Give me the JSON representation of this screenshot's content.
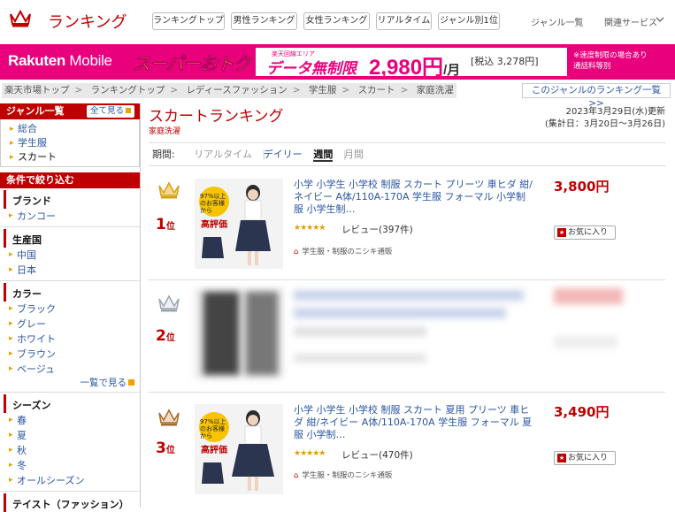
{
  "header": {
    "title": "ランキング",
    "nav": [
      "ランキングトップ",
      "男性ランキング",
      "女性ランキング",
      "リアルタイム",
      "ジャンル別1位"
    ],
    "genre_link": "ジャンル一覧",
    "related": "関連サービス"
  },
  "banner": {
    "brand": "Rakuten",
    "brand2": "Mobile",
    "super": "スーパーおトク",
    "data_top": "楽天回線エリア",
    "data_main": "データ無制限",
    "price": "2,980円",
    "per": "/月",
    "tax": "[税込 3,278円]",
    "note1": "※速度制限の場合あり",
    "note2": "通話料等別"
  },
  "breadcrumb": [
    "楽天市場トップ",
    "ランキングトップ",
    "レディースファッション",
    "学生服",
    "スカート",
    "家庭洗濯"
  ],
  "genre_ranking_link": "このジャンルのランキング一覧 >>",
  "sidebar": {
    "genre_head": "ジャンル一覧",
    "show_all": "全て見る",
    "genres": [
      "総合",
      "学生服",
      "スカート"
    ],
    "cond_head": "条件で絞り込む",
    "brand": {
      "title": "ブランド",
      "items": [
        "カンコー"
      ]
    },
    "origin": {
      "title": "生産国",
      "items": [
        "中国",
        "日本"
      ]
    },
    "color": {
      "title": "カラー",
      "items": [
        "ブラック",
        "グレー",
        "ホワイト",
        "ブラウン",
        "ベージュ"
      ]
    },
    "more": "一覧で見る",
    "season": {
      "title": "シーズン",
      "items": [
        "春",
        "夏",
        "秋",
        "冬",
        "オールシーズン"
      ]
    },
    "taste": {
      "title": "テイスト（ファッション）"
    }
  },
  "main": {
    "title": "スカートランキング",
    "subtitle": "家庭洗濯",
    "updated": "2023年3月29日(水)更新",
    "period_range": "(集計日：3月20日～3月26日)",
    "period_label": "期間:",
    "periods": {
      "realtime": "リアルタイム",
      "daily": "デイリー",
      "weekly": "週間",
      "monthly": "月間"
    }
  },
  "items": [
    {
      "rank": "1",
      "rank_suffix": "位",
      "title": "小学 小学生 小学校 制服 スカート プリーツ 車ヒダ 紺/ネイビー A体/110A-170A 学生服 フォーマル 小学制服 小学生制…",
      "stars": "★★★★★",
      "review": "レビュー(397件)",
      "shop": "学生服・制服のニシキ通販",
      "price": "3,800円",
      "fav": "お気に入り",
      "thumb_badge": "97%以上のお客様から",
      "thumb_label": "高評価"
    },
    {
      "rank": "2",
      "rank_suffix": "位"
    },
    {
      "rank": "3",
      "rank_suffix": "位",
      "title": "小学 小学生 小学校 制服 スカート 夏用 プリーツ 車ヒダ 紺/ネイビー A体/110A-170A 学生服 フォーマル 夏服 小学制…",
      "stars": "★★★★★",
      "review": "レビュー(470件)",
      "shop": "学生服・制服のニシキ通販",
      "price": "3,490円",
      "fav": "お気に入り",
      "thumb_badge": "97%以上のお客様から",
      "thumb_label": "高評価"
    }
  ]
}
